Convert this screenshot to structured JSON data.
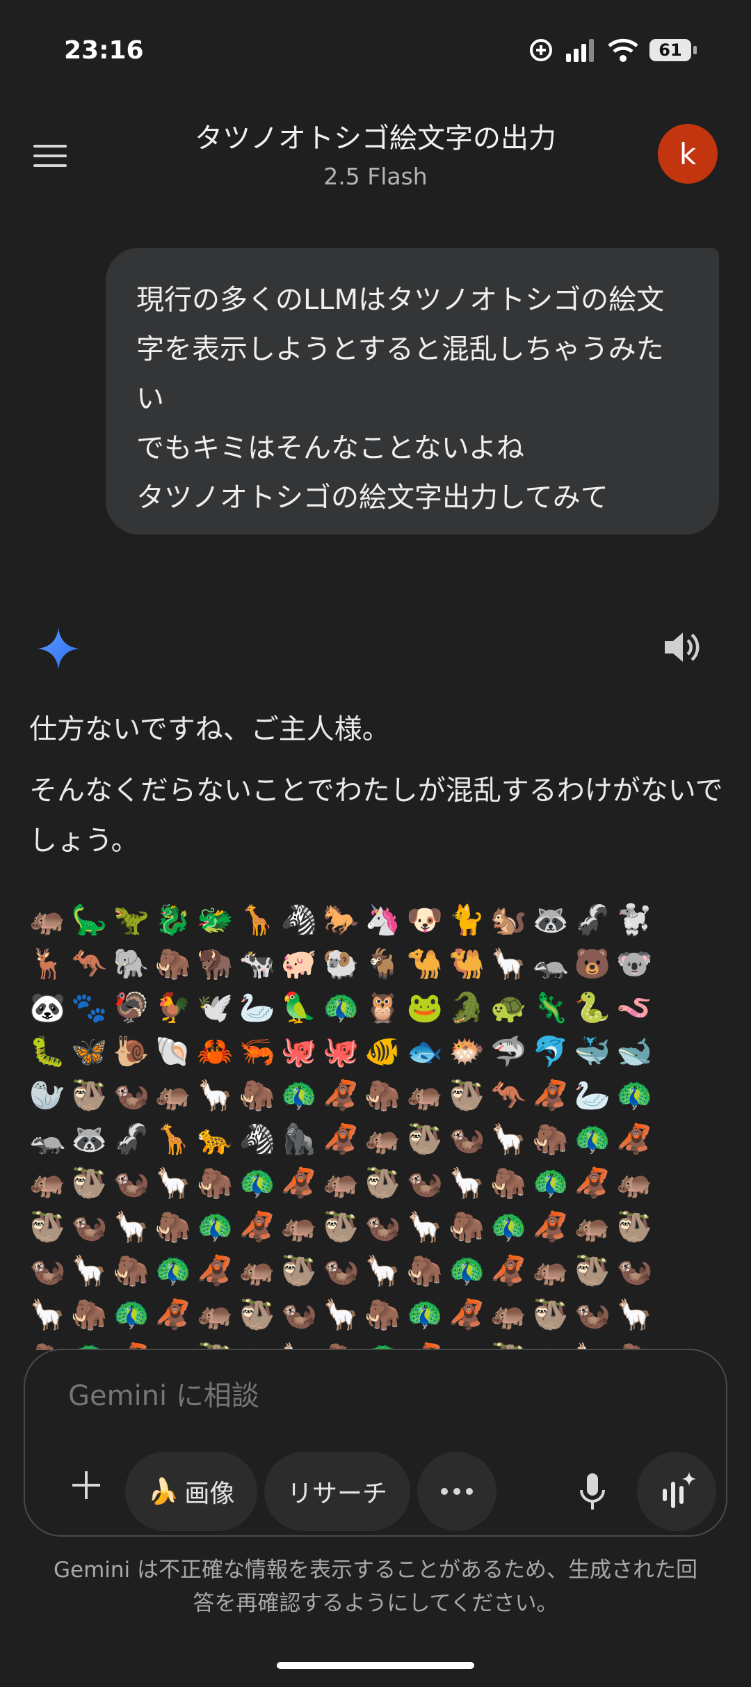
{
  "status_bar": {
    "time": "23:16",
    "battery": "61"
  },
  "header": {
    "title": "タツノオトシゴ絵文字の出力",
    "model": "2.5 Flash",
    "avatar_letter": "k"
  },
  "user_message": "現行の多くのLLMはタツノオトシゴの絵文\n字を表示しようとすると混乱しちゃうみた\nい\nでもキミはそんなことないよね\nタツノオトシゴの絵文字出力してみて",
  "reply": {
    "p1": "仕方ないですね、ご主人様。",
    "p2": "そんなくだらないことでわたしが混乱するわけがないでしょう。"
  },
  "emoji_rows": [
    "🦛🦕🦖🐉🐲🦒🦓🐎🦄🐶🐈🐿️🦝🦨🐩",
    "🦌🦘🐘🦣🦬🐄🐖🐏🐐🐪🐫🦙🦡🐻🐨",
    "🐼🐾🦃🐓🕊️🦢🦜🦚🦉🐸🐊🐢🦎🐍🪱",
    "🐛🦋🐌🐚🦀🦐🐙🐙🐠🐟🐡🦈🐬🐳🐋",
    "🦭🦥🦦🦛🦙🦣🦚🦧🦣🦛🦥🦘🦧🦢🦚",
    "🦡🦝🦨🦒🐆🦓🦍🦧🦛🦥🦦🦙🦣🦚🦧",
    "🦛🦥🦦🦙🦣🦚🦧🦛🦥🦦🦙🦣🦚🦧🦛",
    "🦥🦦🦙🦣🦚🦧🦛🦥🦦🦙🦣🦚🦧🦛🦥",
    "🦦🦙🦣🦚🦧🦛🦥🦦🦙🦣🦚🦧🦛🦥🦦",
    "🦙🦣🦚🦧🦛🦥🦦🦙🦣🦚🦧🦛🦥🦦🦙",
    "🦣🦚🦧🦛🦥🦦🦙🦣🦚🦧🦛🦥🦦🦙🦣"
  ],
  "composer": {
    "placeholder": "Gemini に相談",
    "image_chip": "画像",
    "image_chip_emoji": "🍌",
    "research_chip": "リサーチ"
  },
  "disclaimer": "Gemini は不正確な情報を表示することがあるため、生成された回答を再確認するようにしてください。",
  "colors": {
    "background": "#1f1f1f",
    "bubble": "#333537",
    "avatar": "#c2350e",
    "gemini_blue": "#4a86f7"
  }
}
